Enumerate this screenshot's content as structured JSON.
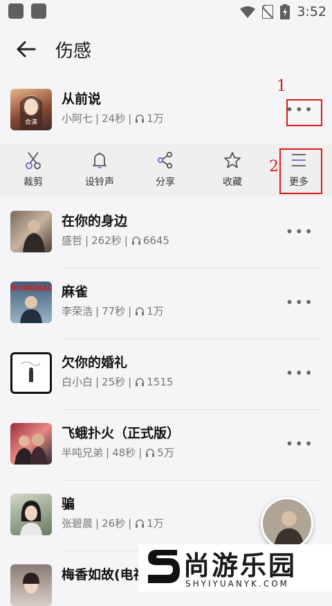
{
  "status": {
    "time": "3:52"
  },
  "header": {
    "title": "伤感"
  },
  "songs": [
    {
      "name": "从前说",
      "artist": "小阿七",
      "duration": "24秒",
      "plays": "1万"
    },
    {
      "name": "在你的身边",
      "artist": "盛哲",
      "duration": "262秒",
      "plays": "6645"
    },
    {
      "name": "麻雀",
      "artist": "李荣浩",
      "duration": "77秒",
      "plays": "1万"
    },
    {
      "name": "欠你的婚礼",
      "artist": "白小白",
      "duration": "25秒",
      "plays": "1515"
    },
    {
      "name": "飞蛾扑火（正式版）",
      "artist": "半吨兄弟",
      "duration": "48秒",
      "plays": "5万"
    },
    {
      "name": "骗",
      "artist": "张碧晨",
      "duration": "26秒",
      "plays": "1万"
    },
    {
      "name": "梅香如故(电视"
    }
  ],
  "cover_texts": {
    "first": "合演",
    "third": "RONGHAO"
  },
  "actions": [
    {
      "label": "裁剪",
      "icon": "scissors-icon"
    },
    {
      "label": "设铃声",
      "icon": "bell-icon"
    },
    {
      "label": "分享",
      "icon": "share-icon"
    },
    {
      "label": "收藏",
      "icon": "star-icon"
    },
    {
      "label": "更多",
      "icon": "menu-icon"
    }
  ],
  "annotations": {
    "one": "1",
    "two": "2"
  },
  "watermark": {
    "name": "尚游乐园",
    "url": "SHYIYUANYK.COM"
  },
  "colors": {
    "annotation_red": "#e01818",
    "accent_purple": "#7b5cd6"
  }
}
